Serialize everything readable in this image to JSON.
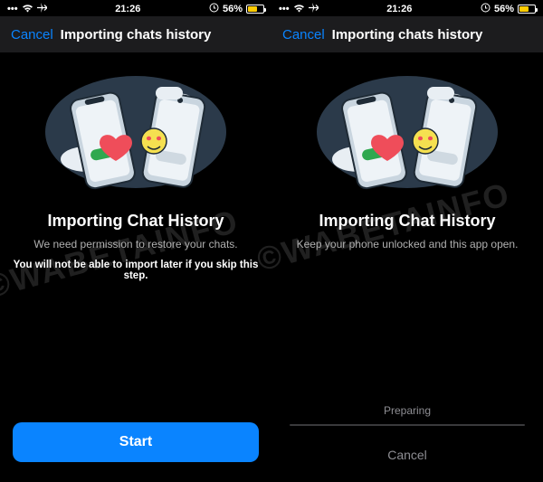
{
  "statusbar": {
    "time": "21:26",
    "battery_pct": "56%",
    "signal_icon": "●●●●",
    "wifi_icon": "wifi"
  },
  "nav": {
    "cancel": "Cancel",
    "title": "Importing chats history"
  },
  "left": {
    "heading": "Importing Chat History",
    "subheading": "We need permission to restore your chats.",
    "warning": "You will not be able to import later if you skip this step.",
    "primary_button": "Start"
  },
  "right": {
    "heading": "Importing Chat History",
    "subheading": "Keep your phone unlocked and this app open.",
    "status_text": "Preparing",
    "cancel_button": "Cancel"
  },
  "watermark": "©WABETAINFO"
}
